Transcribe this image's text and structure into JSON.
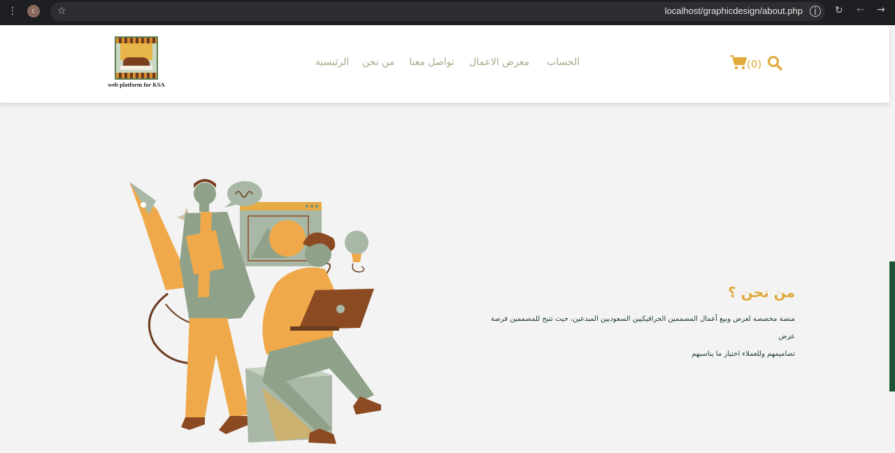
{
  "browser": {
    "profile_initial": "c",
    "url": "localhost/graphicdesign/about.php"
  },
  "header": {
    "logo_text": "web platform for KSA",
    "nav": {
      "account": "الحساب",
      "gallery": "معرض الاعمال",
      "contact": "تواصل معنا",
      "about": "من نحن",
      "home": "الرئيسية"
    },
    "cart_count": "(0)"
  },
  "about": {
    "title": "من نحن ؟",
    "line1": "منصة مخصصة لعرض وبيع أعمال المصممين الجرافيكيين السعوديين المبدعين، حيث تتيح للمصممين فرصة عرض",
    "line2": "تصاميمهم وللعملاء اختيار ما يناسبهم"
  },
  "colors": {
    "accent": "#e0a93a",
    "nav_text": "#a6a98a",
    "body_text": "#1b3a26",
    "page_bg": "#f3f3f3",
    "side_bar": "#1e5234"
  },
  "icons": [
    "menu-kebab-icon",
    "star-icon",
    "info-icon",
    "reload-icon",
    "back-arrow-icon",
    "forward-arrow-icon",
    "cart-icon",
    "search-icon"
  ]
}
